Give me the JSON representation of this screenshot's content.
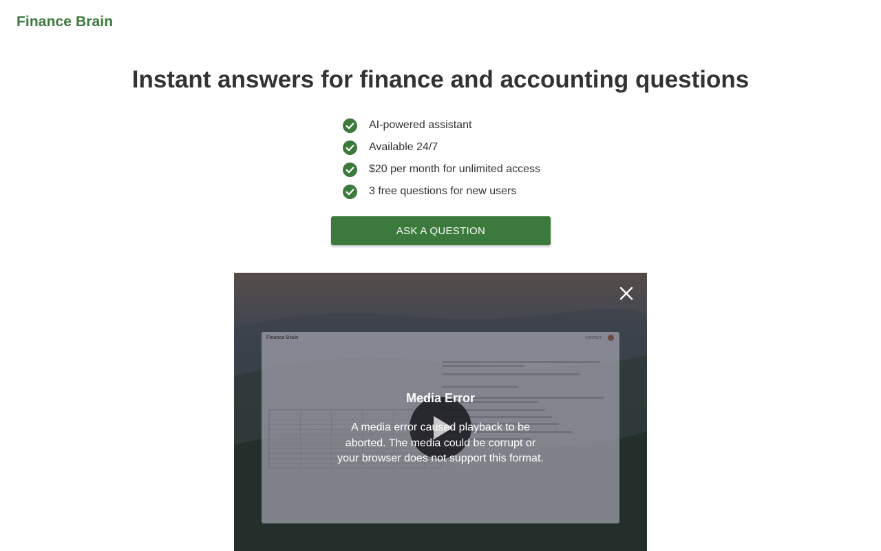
{
  "header": {
    "logo": "Finance Brain"
  },
  "hero": {
    "headline": "Instant answers for finance and accounting questions",
    "features": [
      "AI-powered assistant",
      "Available 24/7",
      "$20 per month for unlimited access",
      "3 free questions for new users"
    ],
    "cta_label": "ASK A QUESTION"
  },
  "video": {
    "thumbnail": {
      "logo": "Finance Brain",
      "contact": "CONTACT"
    },
    "error_title": "Media Error",
    "error_message": "A media error caused playback to be aborted. The media could be corrupt or your browser does not support this format."
  },
  "colors": {
    "brand": "#3b7a3c",
    "text": "#333333"
  }
}
